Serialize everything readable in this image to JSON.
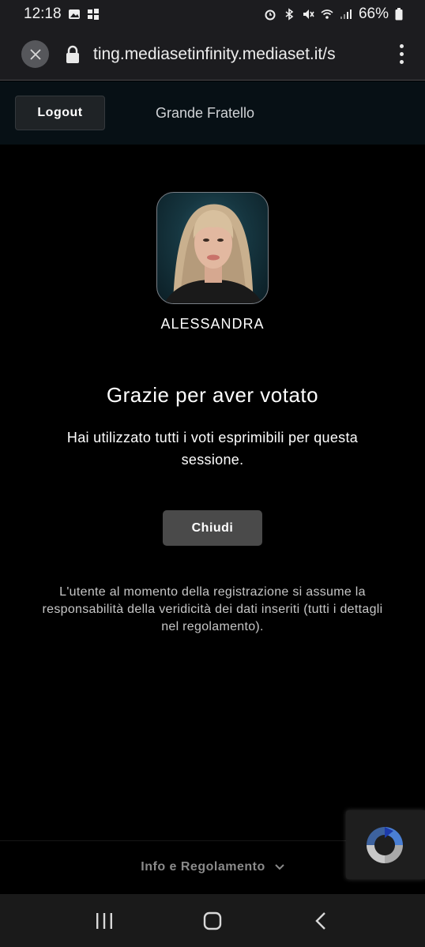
{
  "status": {
    "time": "12:18",
    "battery": "66%"
  },
  "browser": {
    "url": "ting.mediasetinfinity.mediaset.it/s"
  },
  "header": {
    "logout_label": "Logout",
    "show_name": "Grande Fratello"
  },
  "contestant": {
    "name": "ALESSANDRA"
  },
  "confirmation": {
    "title": "Grazie per aver votato",
    "message": "Hai utilizzato tutti i voti esprimibili per questa sessione.",
    "close_label": "Chiudi"
  },
  "disclaimer": "L'utente al momento della registrazione si assume la responsabilità della veridicità dei dati inseriti (tutti i dettagli nel regolamento).",
  "footer": {
    "info_label": "Info e Regolamento"
  },
  "icons": {
    "status_left": [
      "gallery-icon",
      "windows-icon"
    ],
    "status_right": [
      "alarm-icon",
      "bluetooth-icon",
      "mute-icon",
      "wifi-icon",
      "signal-icon",
      "battery-icon"
    ],
    "nav": [
      "recent-apps-icon",
      "home-icon",
      "back-icon"
    ]
  },
  "colors": {
    "background": "#000000",
    "header_bg": "#071015",
    "button_bg": "#4a4a4a",
    "recaptcha_blue": "#4a7fd4"
  }
}
